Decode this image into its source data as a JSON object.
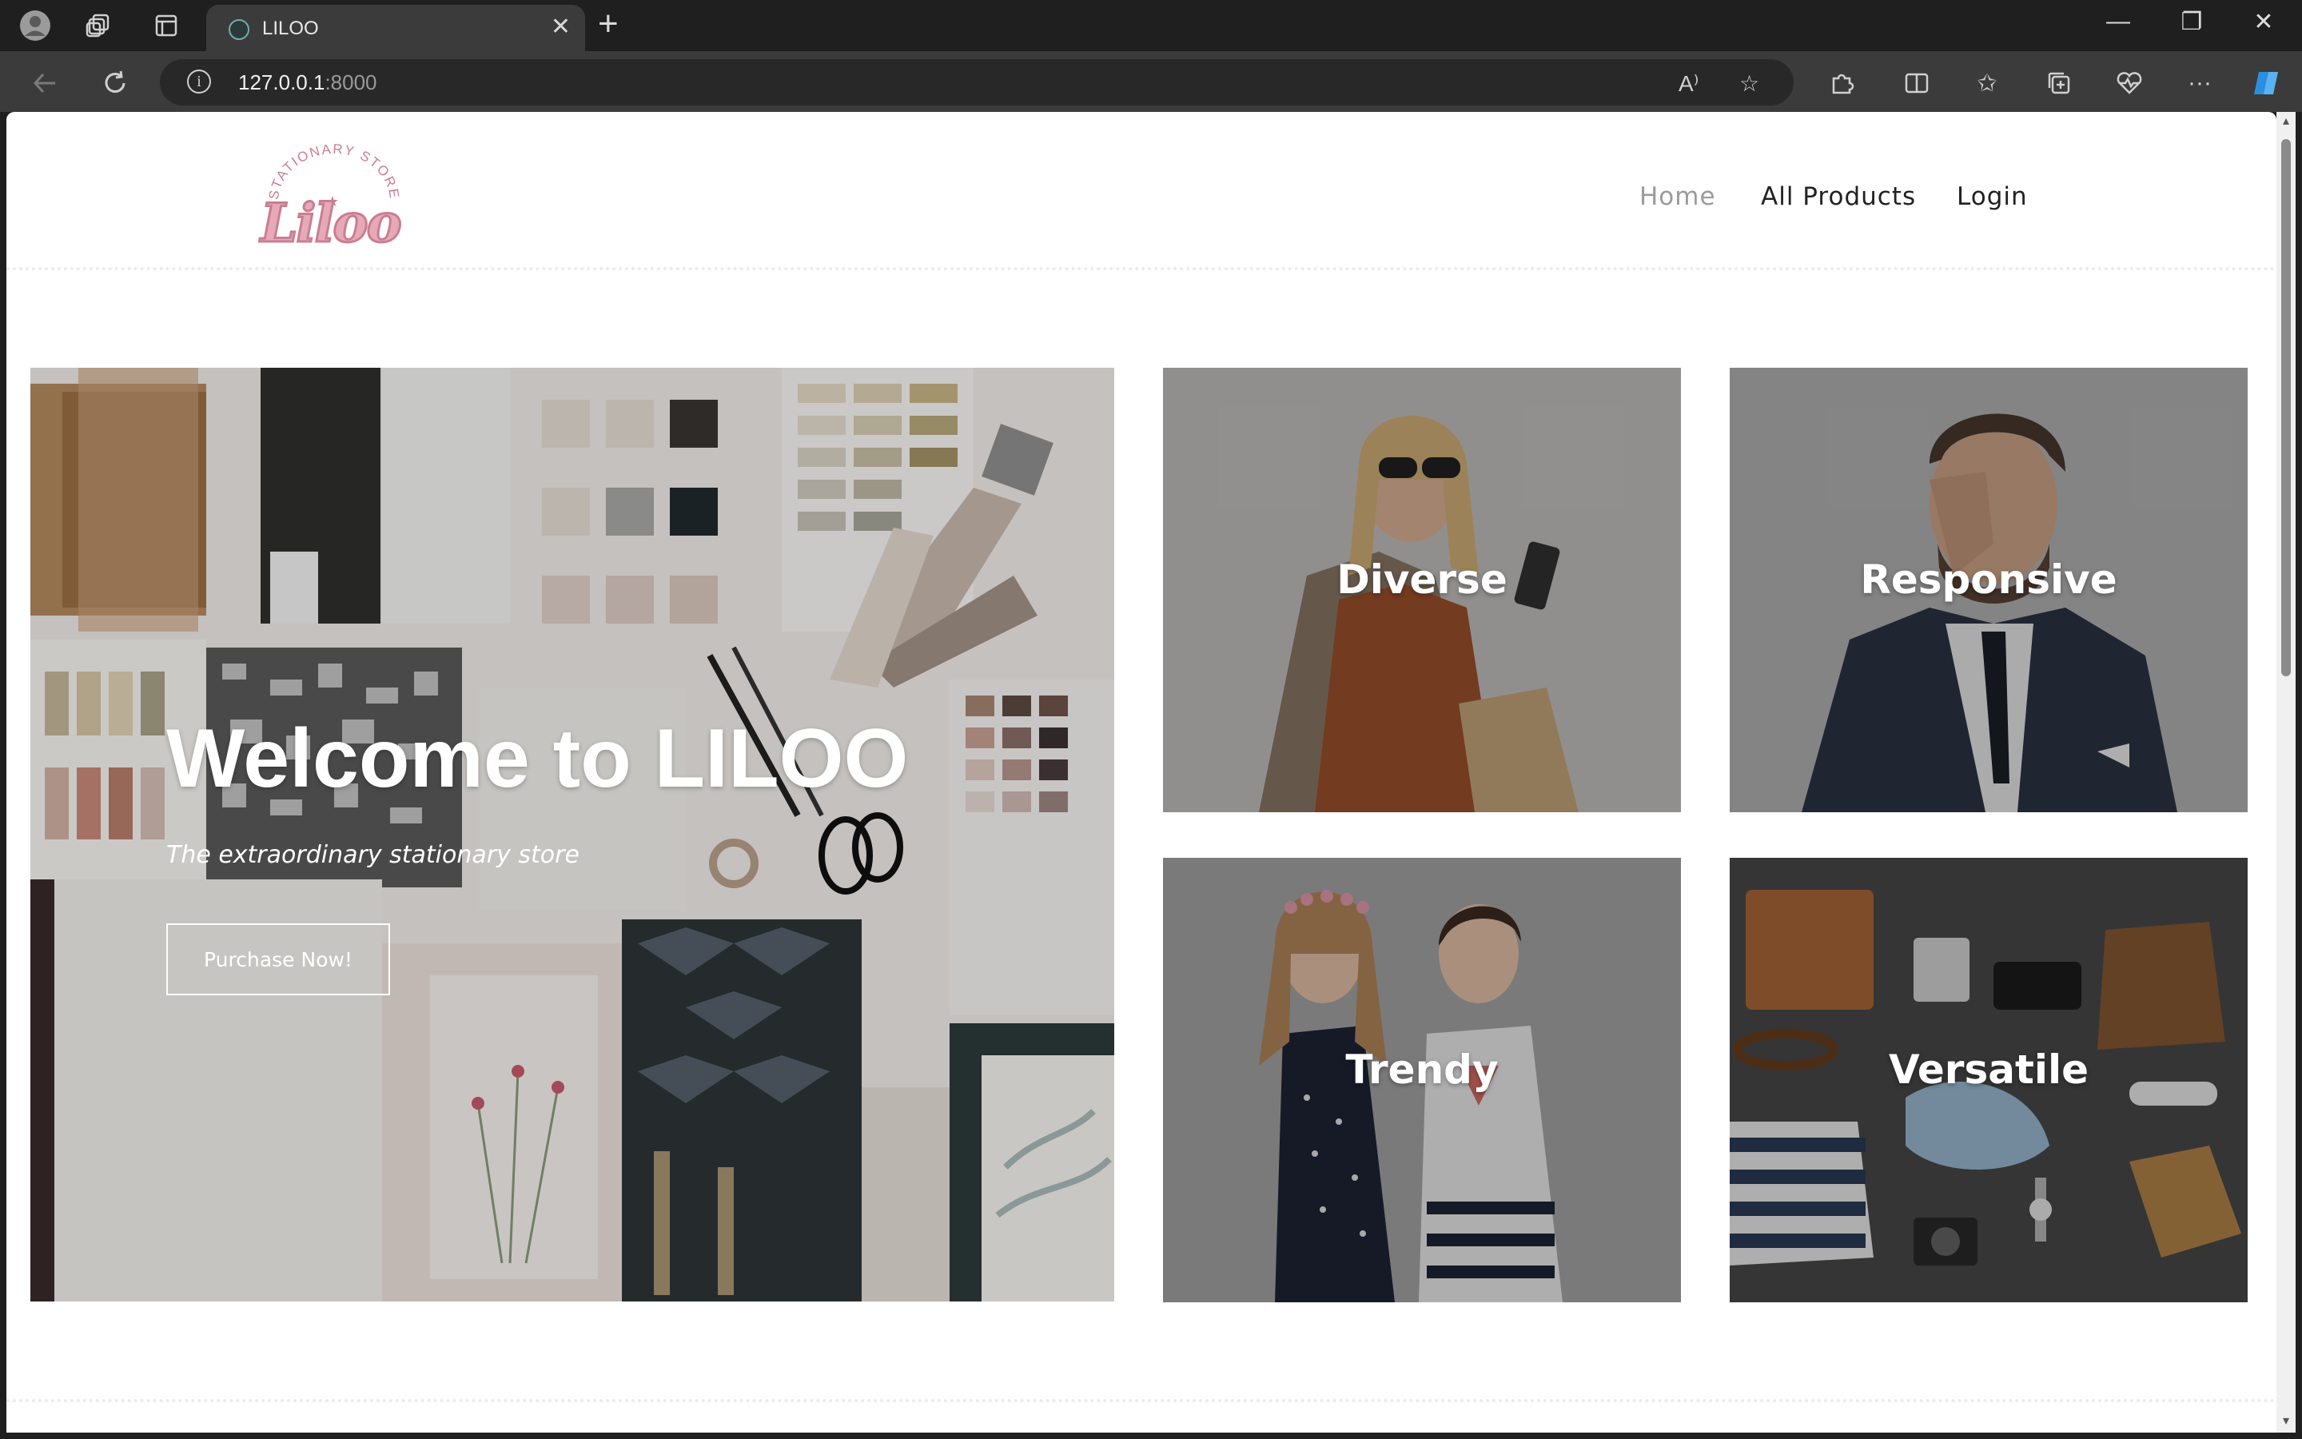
{
  "browser": {
    "tab_title": "LILOO",
    "url_host": "127.0.0.1",
    "url_port": ":8000",
    "icons": [
      "profile-icon",
      "workspaces-icon",
      "tab-actions-icon",
      "back-icon",
      "refresh-icon",
      "read-aloud-icon",
      "favorite-icon",
      "extensions-icon",
      "split-screen-icon",
      "favorites-icon",
      "collections-icon",
      "performance-icon",
      "more-icon",
      "copilot-icon"
    ]
  },
  "site": {
    "logo_arc": "STATIONARY STORE",
    "logo_script": "Liloo",
    "nav": {
      "home": "Home",
      "products": "All Products",
      "login": "Login"
    }
  },
  "hero": {
    "title": "Welcome to LILOO",
    "subtitle": "The extraordinary stationary store",
    "button": "Purchase Now!"
  },
  "tiles": [
    {
      "label": "Diverse"
    },
    {
      "label": "Responsive"
    },
    {
      "label": "Trendy"
    },
    {
      "label": "Versatile"
    }
  ],
  "colors": {
    "accent_pink": "#e7a9b8",
    "nav_active": "#9b9b9b",
    "nav_text": "#222222"
  }
}
